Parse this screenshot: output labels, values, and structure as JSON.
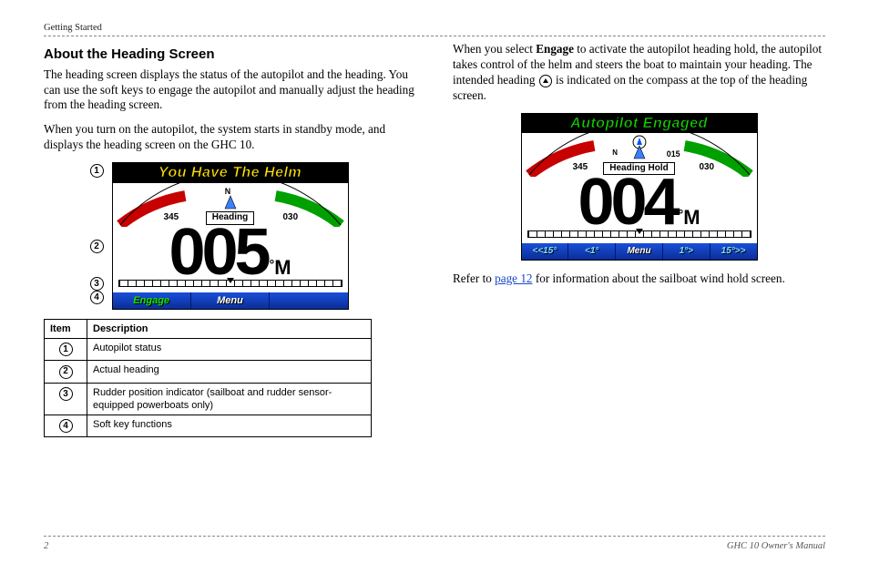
{
  "header": {
    "section": "Getting Started"
  },
  "left": {
    "title": "About the Heading Screen",
    "p1": "The heading screen displays the status of the autopilot and the heading. You can use the soft keys to engage the autopilot and manually adjust the heading from the heading screen.",
    "p2": "When you turn on the autopilot, the system starts in standby mode, and displays the heading screen on the GHC 10."
  },
  "device1": {
    "status": "You Have The Helm",
    "heading_label": "Heading",
    "heading_value": "005",
    "ticks": {
      "left": "345",
      "nlabel": "N",
      "right": "030"
    },
    "mag": "M",
    "softkeys": [
      "Engage",
      "Menu",
      ""
    ]
  },
  "markers": [
    "1",
    "2",
    "3",
    "4"
  ],
  "table": {
    "head_item": "Item",
    "head_desc": "Description",
    "rows": [
      {
        "n": "1",
        "d": "Autopilot status"
      },
      {
        "n": "2",
        "d": "Actual heading"
      },
      {
        "n": "3",
        "d": "Rudder position indicator (sailboat and rudder sensor-equipped powerboats only)"
      },
      {
        "n": "4",
        "d": "Soft key functions"
      }
    ]
  },
  "right": {
    "p1a": "When you select ",
    "p1_bold": "Engage",
    "p1b": " to activate the autopilot heading hold, the autopilot takes control of the helm and steers the boat to maintain your heading. The intended heading ",
    "p1c": " is indicated on the compass at the top of the heading screen.",
    "refer_a": "Refer to ",
    "page_link": "page 12",
    "refer_b": " for information about the sailboat wind hold screen."
  },
  "device2": {
    "status": "Autopilot Engaged",
    "heading_label": "Heading Hold",
    "heading_value": "004",
    "ticks": {
      "left": "345",
      "nlabel": "N",
      "right2": "015",
      "right": "030"
    },
    "mag": "M",
    "softkeys": [
      "<<15°",
      "<1°",
      "Menu",
      "1°>",
      "15°>>"
    ]
  },
  "footer": {
    "page": "2",
    "title": "GHC 10 Owner's Manual"
  }
}
